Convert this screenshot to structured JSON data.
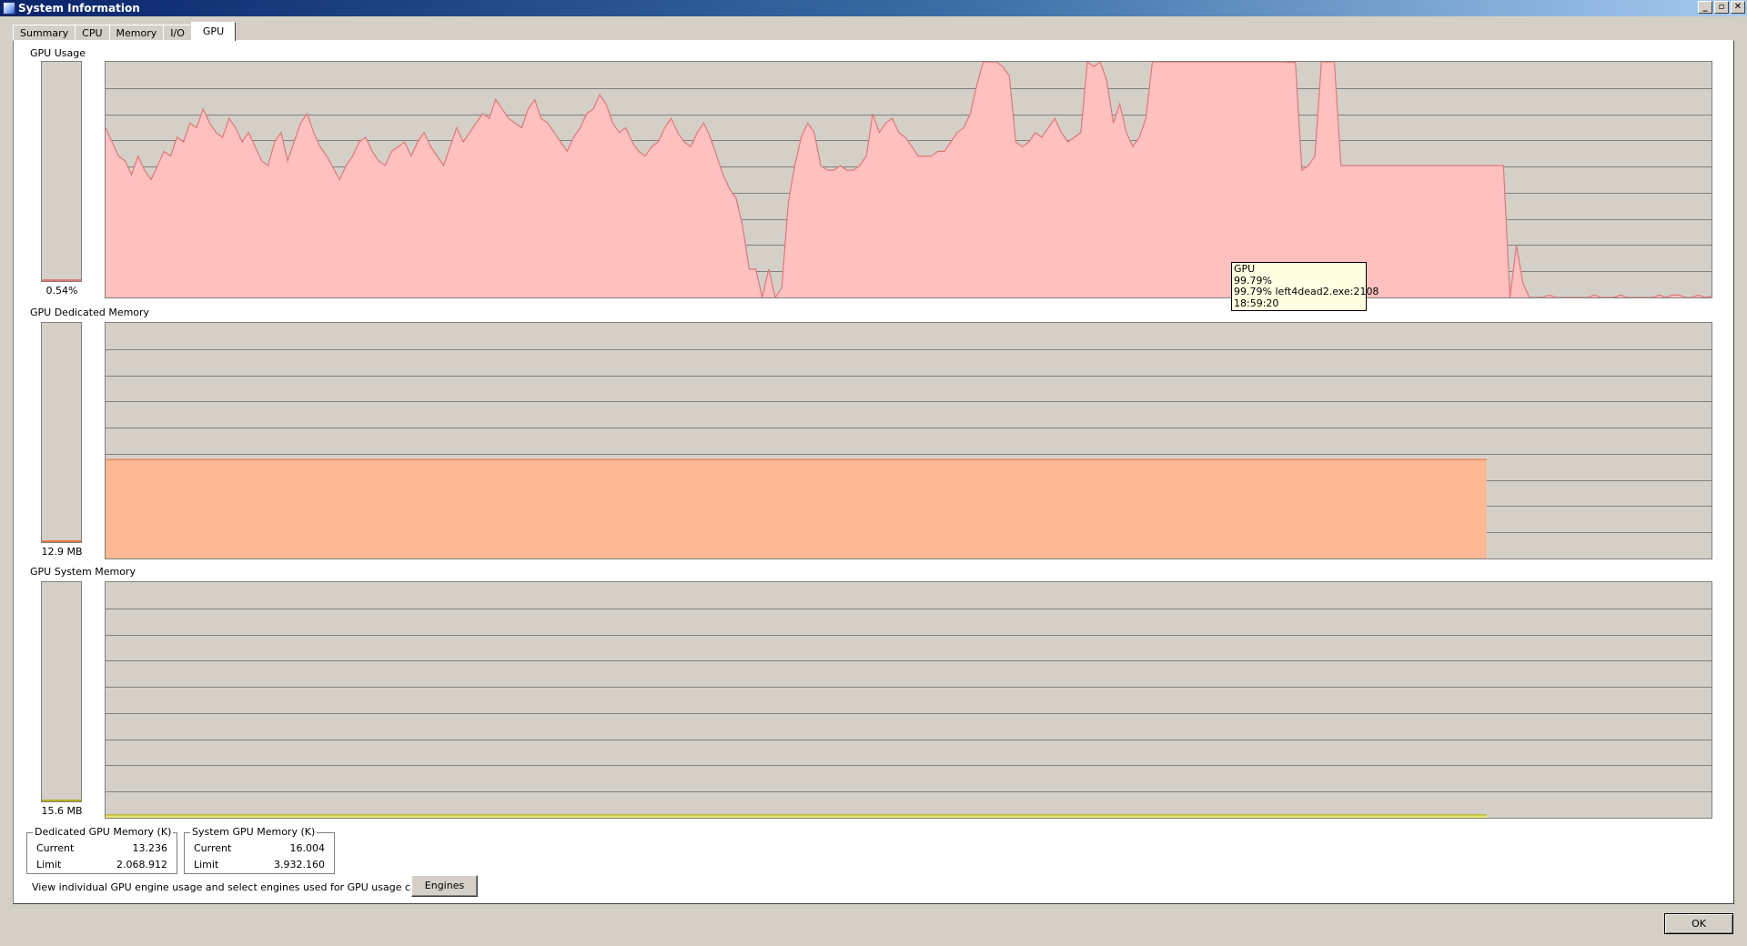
{
  "window": {
    "title": "System Information",
    "controls": {
      "minimize": "_",
      "restore": "▫",
      "close": "✕"
    }
  },
  "tabs": [
    {
      "label": "Summary",
      "active": false
    },
    {
      "label": "CPU",
      "active": false
    },
    {
      "label": "Memory",
      "active": false
    },
    {
      "label": "I/O",
      "active": false
    },
    {
      "label": "GPU",
      "active": true
    }
  ],
  "gpu_usage": {
    "label": "GPU Usage",
    "current_value": "0.54%",
    "current_fraction": 0.0054,
    "color_fill": "#ffc0c0",
    "color_line": "#e07878",
    "y_max": 100,
    "series": [
      72,
      66,
      60,
      58,
      52,
      60,
      54,
      50,
      56,
      62,
      60,
      68,
      66,
      74,
      72,
      80,
      74,
      70,
      68,
      76,
      72,
      66,
      70,
      64,
      58,
      56,
      66,
      70,
      58,
      66,
      74,
      78,
      70,
      64,
      60,
      55,
      50,
      56,
      60,
      66,
      68,
      62,
      58,
      56,
      62,
      64,
      66,
      60,
      66,
      70,
      64,
      60,
      56,
      64,
      72,
      66,
      70,
      74,
      78,
      76,
      84,
      80,
      76,
      74,
      72,
      80,
      84,
      76,
      74,
      70,
      66,
      62,
      68,
      72,
      78,
      80,
      86,
      82,
      74,
      70,
      72,
      66,
      62,
      60,
      64,
      66,
      72,
      76,
      70,
      66,
      64,
      70,
      74,
      68,
      60,
      52,
      46,
      42,
      30,
      12,
      12,
      0,
      12,
      0,
      4,
      40,
      56,
      68,
      74,
      70,
      56,
      54,
      54,
      56,
      54,
      54,
      56,
      60,
      78,
      70,
      74,
      76,
      70,
      68,
      64,
      60,
      60,
      60,
      62,
      62,
      66,
      70,
      72,
      78,
      90,
      100,
      100,
      100,
      98,
      94,
      66,
      64,
      66,
      70,
      68,
      72,
      76,
      70,
      66,
      68,
      70,
      100,
      98,
      100,
      92,
      74,
      82,
      70,
      64,
      68,
      76,
      100,
      100,
      100,
      100,
      100,
      100,
      100,
      100,
      100,
      100,
      100,
      100,
      100,
      100,
      100,
      100,
      100,
      100,
      100,
      100,
      100,
      99.79,
      99.79,
      54,
      56,
      60,
      100,
      100,
      100,
      56,
      56,
      56,
      56,
      56,
      56,
      56,
      56,
      56,
      56,
      56,
      56,
      56,
      56,
      56,
      56,
      56,
      56,
      56,
      56,
      56,
      56,
      56,
      56,
      56,
      56,
      0,
      22,
      6,
      0,
      0,
      0,
      1,
      0,
      0,
      0,
      0,
      0,
      0,
      1,
      0,
      0,
      0,
      1,
      0,
      0,
      0,
      0,
      0,
      1,
      0,
      1,
      1,
      0,
      0,
      1,
      0,
      0.54
    ],
    "tooltip": {
      "title": "GPU",
      "value": "99.79%",
      "process": "99.79% left4dead2.exe:2108",
      "time": "18:59:20"
    }
  },
  "gpu_dedicated_memory": {
    "label": "GPU Dedicated Memory",
    "current_value": "12.9 MB",
    "current_fraction": 0.006,
    "color_fill": "#ffb895",
    "color_line": "#e8783c",
    "y_max": 100,
    "series": [
      42,
      42,
      42,
      42,
      42,
      42,
      42,
      42,
      42,
      42,
      42,
      42,
      42,
      42,
      42,
      42,
      42,
      42,
      42,
      42,
      42,
      42,
      42,
      42,
      42,
      42,
      42,
      42,
      42,
      42,
      42,
      42,
      42,
      42,
      42,
      42,
      42,
      42,
      42,
      42,
      42,
      42,
      42,
      42,
      42,
      42,
      42,
      42,
      42,
      42,
      42,
      42,
      42,
      42,
      42,
      42,
      42,
      42,
      42,
      42,
      42,
      42,
      42,
      42,
      42,
      42,
      42,
      42,
      42,
      42,
      42,
      42,
      42,
      42,
      42,
      42,
      42,
      42,
      42,
      42,
      42,
      42,
      42,
      42,
      42,
      42,
      42,
      42,
      42,
      42,
      42,
      42,
      42,
      42,
      42,
      42,
      42,
      42,
      42,
      42,
      42,
      42,
      42,
      42,
      42,
      42,
      42,
      42,
      42,
      42,
      42,
      42,
      42,
      42,
      42,
      42,
      42,
      42,
      42,
      42,
      42,
      42,
      42,
      42,
      42,
      42,
      42,
      42,
      42,
      42,
      42,
      42,
      42,
      42,
      42,
      42,
      42,
      42,
      42,
      42,
      42,
      42,
      42,
      42,
      42,
      42,
      42,
      42,
      42,
      42,
      42,
      42,
      42,
      42,
      42,
      42,
      42,
      42,
      42,
      42,
      42,
      42,
      42,
      42,
      42,
      42,
      42,
      42,
      42,
      42,
      42,
      42,
      42,
      42,
      42,
      42,
      42,
      42,
      42,
      42,
      42,
      42,
      42,
      42,
      42,
      42,
      42,
      42,
      42,
      42,
      42,
      42,
      42,
      42,
      42,
      42,
      42,
      42,
      42,
      42,
      42,
      42,
      42,
      42,
      42,
      42,
      42,
      42,
      42,
      42,
      42,
      42,
      42,
      42,
      42,
      42,
      42,
      42,
      42,
      42,
      42,
      42,
      42,
      42,
      42,
      42,
      42,
      42,
      42,
      42,
      42,
      42,
      42,
      42,
      42,
      42,
      42,
      42,
      42,
      42,
      42,
      42,
      42,
      42,
      42,
      42,
      42,
      42,
      42,
      42,
      42,
      42,
      42,
      42,
      42,
      42,
      42,
      42,
      42,
      42,
      42,
      42,
      42,
      42,
      42,
      42,
      42,
      42,
      42,
      42
    ]
  },
  "gpu_system_memory": {
    "label": "GPU System Memory",
    "current_value": "15.6 MB",
    "current_fraction": 0.006,
    "color_fill": "#e8e870",
    "color_line": "#b8b020",
    "y_max": 100,
    "series": [
      1.2
    ]
  },
  "dedicated_box": {
    "title": "Dedicated GPU Memory (K)",
    "rows": [
      {
        "label": "Current",
        "value": "13.236"
      },
      {
        "label": "Limit",
        "value": "2.068.912"
      }
    ]
  },
  "system_box": {
    "title": "System GPU Memory (K)",
    "rows": [
      {
        "label": "Current",
        "value": "16.004"
      },
      {
        "label": "Limit",
        "value": "3.932.160"
      }
    ]
  },
  "engines": {
    "description": "View individual GPU engine usage and select engines used for GPU usage calculations:",
    "button_label": "Engines"
  },
  "footer": {
    "ok_label": "OK"
  }
}
